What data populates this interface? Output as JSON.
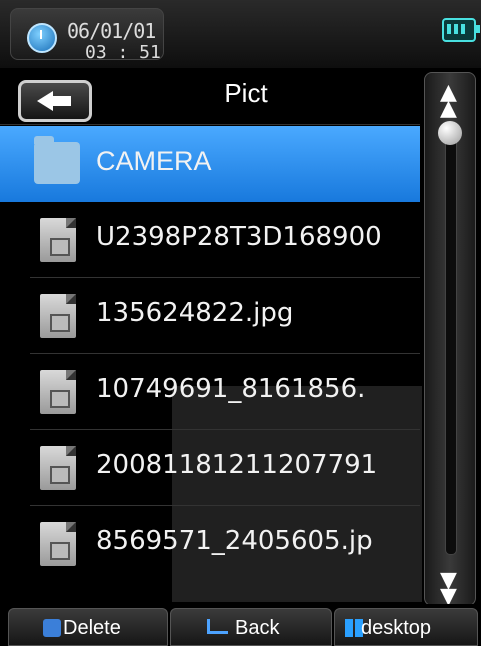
{
  "status_bar": {
    "date": "06/01/01",
    "time": "03 : 51",
    "clock_icon": "clock-icon",
    "battery_icon": "battery-icon"
  },
  "header": {
    "title": "Pict",
    "back_icon": "back-arrow-icon"
  },
  "list": {
    "items": [
      {
        "label": "CAMERA",
        "type": "folder",
        "selected": true
      },
      {
        "label": "U2398P28T3D168900",
        "type": "file",
        "selected": false
      },
      {
        "label": "135624822.jpg",
        "type": "file",
        "selected": false
      },
      {
        "label": "10749691_8161856.",
        "type": "file",
        "selected": false
      },
      {
        "label": "20081181211207791",
        "type": "file",
        "selected": false
      },
      {
        "label": "8569571_2405605.jp",
        "type": "file",
        "selected": false
      }
    ]
  },
  "scrollbar": {
    "up_icon": "scroll-up-icon",
    "down_icon": "scroll-down-icon"
  },
  "bottom_bar": {
    "delete_label": "Delete",
    "back_label": "Back",
    "desktop_label": "desktop"
  },
  "colors": {
    "selected_row": "#2b8cf0",
    "accent": "#49e0e0"
  }
}
